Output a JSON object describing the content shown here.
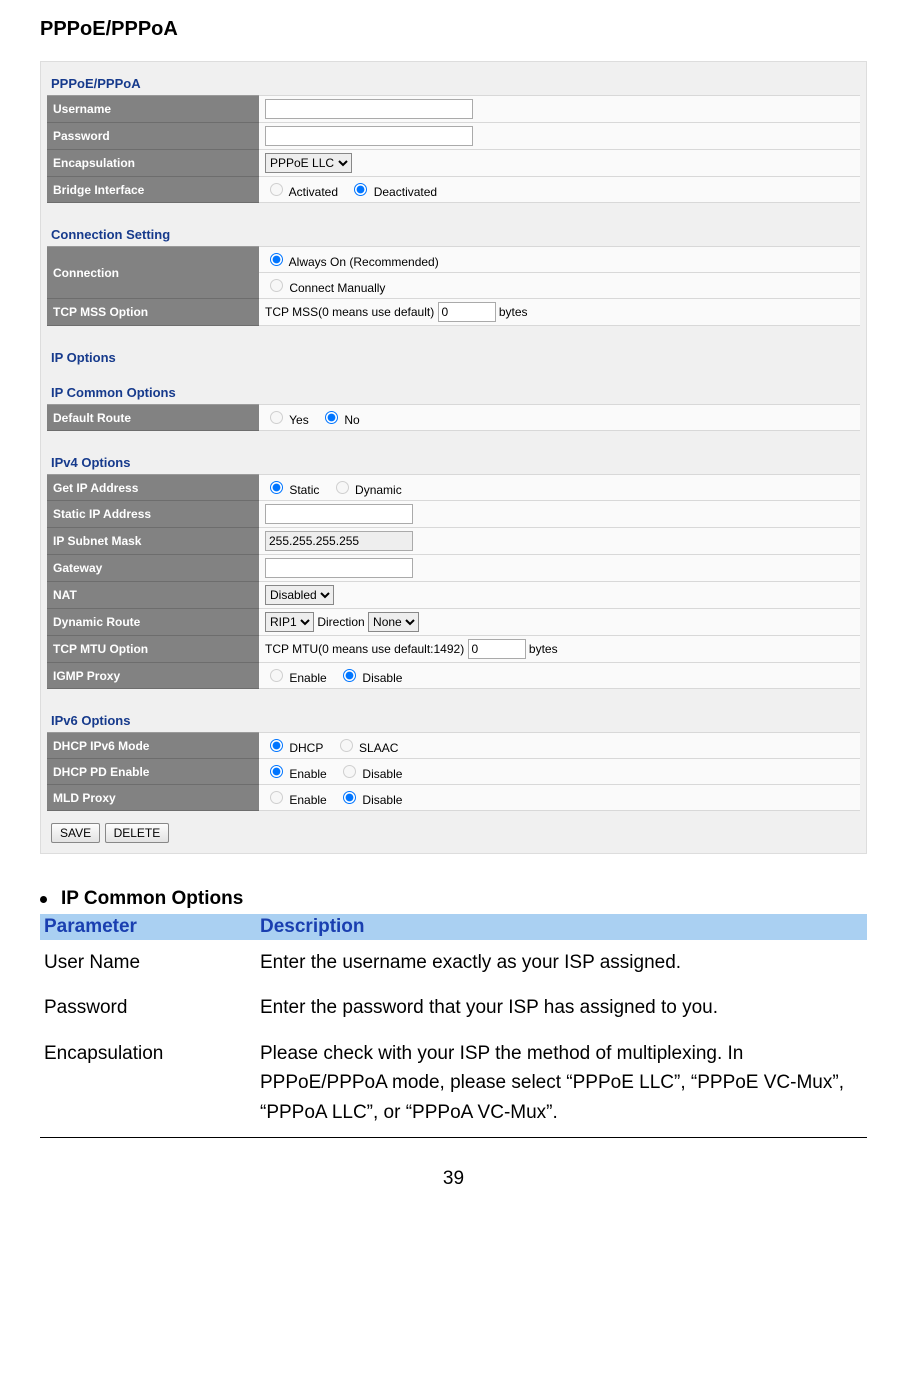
{
  "page_title": "PPPoE/PPPoA",
  "panel": {
    "pppoe": {
      "title": "PPPoE/PPPoA",
      "rows": {
        "username": {
          "label": "Username",
          "value": ""
        },
        "password": {
          "label": "Password",
          "value": ""
        },
        "encapsulation": {
          "label": "Encapsulation",
          "value": "PPPoE LLC"
        },
        "bridge": {
          "label": "Bridge Interface",
          "activated": "Activated",
          "deactivated": "Deactivated"
        }
      }
    },
    "conn": {
      "title": "Connection Setting",
      "rows": {
        "connection": {
          "label": "Connection",
          "opt1": "Always On (Recommended)",
          "opt2": "Connect Manually"
        },
        "tcpmss": {
          "label": "TCP MSS Option",
          "prefix": "TCP MSS(0 means use default)",
          "value": "0",
          "suffix": "bytes"
        }
      }
    },
    "ipopt_title": "IP Options",
    "ipcommon": {
      "title": "IP Common Options",
      "rows": {
        "defroute": {
          "label": "Default Route",
          "yes": "Yes",
          "no": "No"
        }
      }
    },
    "ipv4": {
      "title": "IPv4 Options",
      "rows": {
        "getip": {
          "label": "Get IP Address",
          "static": "Static",
          "dynamic": "Dynamic"
        },
        "staticip": {
          "label": "Static IP Address",
          "value": ""
        },
        "subnet": {
          "label": "IP Subnet Mask",
          "value": "255.255.255.255"
        },
        "gateway": {
          "label": "Gateway",
          "value": ""
        },
        "nat": {
          "label": "NAT",
          "value": "Disabled"
        },
        "dynroute": {
          "label": "Dynamic Route",
          "rip": "RIP1",
          "dirlabel": "Direction",
          "dir": "None"
        },
        "mtu": {
          "label": "TCP MTU Option",
          "prefix": "TCP MTU(0 means use default:1492)",
          "value": "0",
          "suffix": "bytes"
        },
        "igmp": {
          "label": "IGMP Proxy",
          "enable": "Enable",
          "disable": "Disable"
        }
      }
    },
    "ipv6": {
      "title": "IPv6 Options",
      "rows": {
        "dhcpmode": {
          "label": "DHCP IPv6 Mode",
          "dhcp": "DHCP",
          "slaac": "SLAAC"
        },
        "pd": {
          "label": "DHCP PD Enable",
          "enable": "Enable",
          "disable": "Disable"
        },
        "mld": {
          "label": "MLD Proxy",
          "enable": "Enable",
          "disable": "Disable"
        }
      }
    },
    "buttons": {
      "save": "SAVE",
      "delete": "DELETE"
    }
  },
  "desc": {
    "heading": "IP Common Options",
    "th_param": "Parameter",
    "th_desc": "Description",
    "rows": [
      {
        "param": "User Name",
        "text": "Enter the username exactly as your ISP assigned."
      },
      {
        "param": "Password",
        "text": "Enter the password that your ISP has assigned to you."
      },
      {
        "param": "Encapsulation",
        "text": "Please check with your ISP the method of multiplexing. In PPPoE/PPPoA mode, please select “PPPoE LLC”, “PPPoE VC-Mux”, “PPPoA LLC”, or “PPPoA VC-Mux”."
      }
    ]
  },
  "page_number": "39"
}
